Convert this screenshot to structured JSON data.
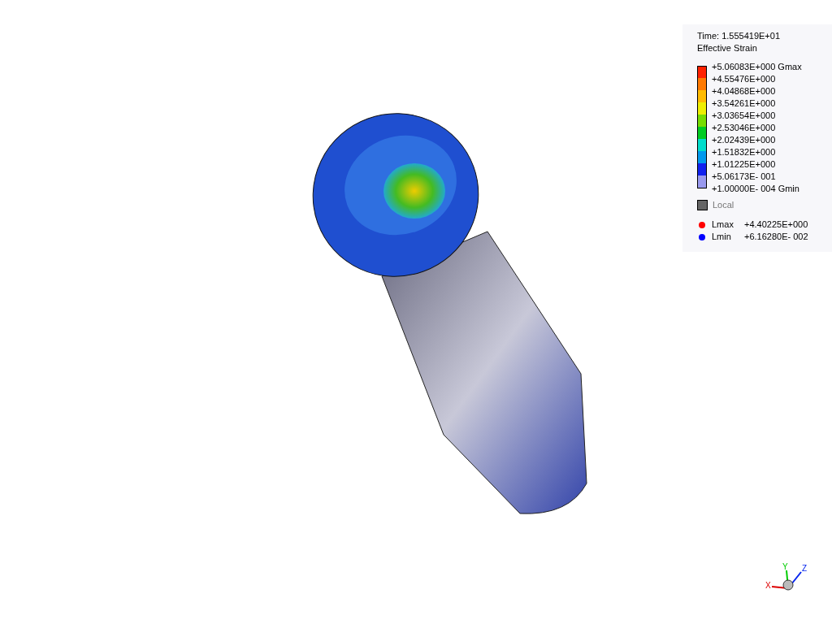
{
  "legend": {
    "time": "Time: 1.555419E+01",
    "title": "Effective Strain",
    "bands": [
      {
        "label": "+5.06083E+000 Gmax",
        "color": "#ff2200"
      },
      {
        "label": "+4.55476E+000",
        "color": "#ff7a00"
      },
      {
        "label": "+4.04868E+000",
        "color": "#ffbb00"
      },
      {
        "label": "+3.54261E+000",
        "color": "#eeee00"
      },
      {
        "label": "+3.03654E+000",
        "color": "#77dd00"
      },
      {
        "label": "+2.53046E+000",
        "color": "#00cc22"
      },
      {
        "label": "+2.02439E+000",
        "color": "#00ddcc"
      },
      {
        "label": "+1.51832E+000",
        "color": "#0099ee"
      },
      {
        "label": "+1.01225E+000",
        "color": "#1122ee"
      },
      {
        "label": "+5.06173E- 001",
        "color": "#9999ee"
      }
    ],
    "min_label": "+1.00000E- 004 Gmin",
    "local": {
      "label": "Local",
      "disabled": true
    },
    "extremes": [
      {
        "name": "Lmax",
        "value": "+4.40225E+000",
        "color": "#ff0000"
      },
      {
        "name": "Lmin",
        "value": "+6.16280E- 002",
        "color": "#0000ff"
      }
    ]
  },
  "triad": {
    "x": "X",
    "y": "Y",
    "z": "Z"
  }
}
